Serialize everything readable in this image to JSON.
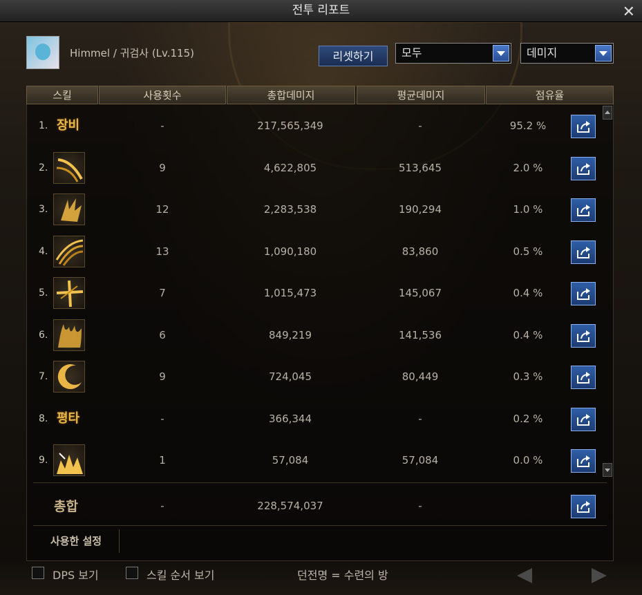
{
  "window": {
    "title": "전투 리포트",
    "close_symbol": "✕"
  },
  "player": {
    "info": "Himmel / 귀검사 (Lv.115)"
  },
  "controls": {
    "reset_label": "리셋하기",
    "filter_select": "모두",
    "type_select": "데미지"
  },
  "table": {
    "headers": [
      "스킬",
      "사용횟수",
      "총합데미지",
      "평균데미지",
      "점유율"
    ],
    "rows": [
      {
        "rank": "1.",
        "skill": "장비",
        "icon": "text",
        "uses": "-",
        "total": "217,565,349",
        "avg": "-",
        "share": "95.2 %"
      },
      {
        "rank": "2.",
        "skill": "",
        "icon": "slash-arc-icon",
        "uses": "9",
        "total": "4,622,805",
        "avg": "513,645",
        "share": "2.0 %"
      },
      {
        "rank": "3.",
        "skill": "",
        "icon": "blade-burst-icon",
        "uses": "12",
        "total": "2,283,538",
        "avg": "190,294",
        "share": "1.0 %"
      },
      {
        "rank": "4.",
        "skill": "",
        "icon": "claw-wave-icon",
        "uses": "13",
        "total": "1,090,180",
        "avg": "83,860",
        "share": "0.5 %"
      },
      {
        "rank": "5.",
        "skill": "",
        "icon": "cross-strike-icon",
        "uses": "7",
        "total": "1,015,473",
        "avg": "145,067",
        "share": "0.4 %"
      },
      {
        "rank": "6.",
        "skill": "",
        "icon": "flame-fan-icon",
        "uses": "6",
        "total": "849,219",
        "avg": "141,536",
        "share": "0.4 %"
      },
      {
        "rank": "7.",
        "skill": "",
        "icon": "crescent-icon",
        "uses": "9",
        "total": "724,045",
        "avg": "80,449",
        "share": "0.3 %"
      },
      {
        "rank": "8.",
        "skill": "평타",
        "icon": "text",
        "uses": "-",
        "total": "366,344",
        "avg": "-",
        "share": "0.2 %"
      },
      {
        "rank": "9.",
        "skill": "",
        "icon": "spike-flame-icon",
        "uses": "1",
        "total": "57,084",
        "avg": "57,084",
        "share": "0.0 %"
      }
    ],
    "total": {
      "label": "총합",
      "uses": "-",
      "total": "228,574,037",
      "avg": "-"
    }
  },
  "tabs": {
    "settings_label": "사용한 설정"
  },
  "footer": {
    "dps_label": "DPS 보기",
    "order_label": "스킬 순서 보기",
    "dungeon_text": "던전명 = 수련의 방"
  },
  "colors": {
    "accent_blue": "#2f5ea6",
    "gold": "#e8b84a"
  }
}
